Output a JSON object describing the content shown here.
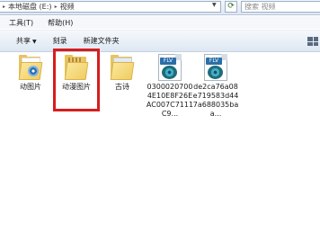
{
  "address_bar": {
    "crumbs": [
      "本地磁盘 (E:)",
      "视频"
    ],
    "search_placeholder": "搜索 视频"
  },
  "menu": [
    "工具(T)",
    "帮助(H)"
  ],
  "toolbar": {
    "share_label": "共享",
    "burn_label": "刻录",
    "new_folder_label": "新建文件夹"
  },
  "files": [
    {
      "name": "动图片",
      "type": "folder"
    },
    {
      "name": "动漫图片",
      "type": "folder",
      "highlighted": true
    },
    {
      "name": "古诗",
      "type": "folder"
    },
    {
      "name": "03000207004E10E8F26EAC007C7111C9...",
      "type": "flv",
      "badge": "FLV"
    },
    {
      "name": "de2ca76a08e719583d447a688035baa...",
      "type": "flv",
      "badge": "FLV"
    }
  ],
  "colors": {
    "highlight": "#d61d1d",
    "folder": "#f0cd63"
  }
}
